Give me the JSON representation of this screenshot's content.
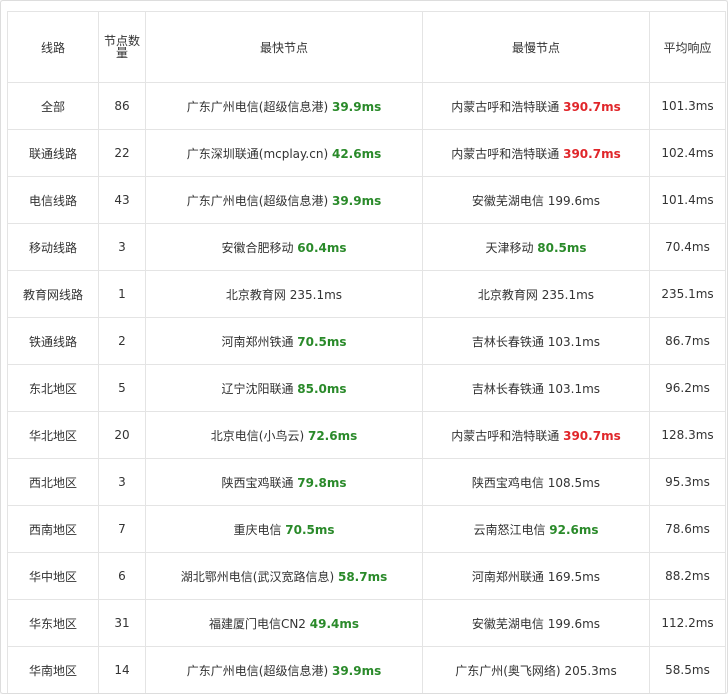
{
  "colors": {
    "fast": "#2a8a2a",
    "slow": "#e0262a",
    "normal": "#333333"
  },
  "headers": {
    "line": "线路",
    "count_line1": "节点数",
    "count_line2": "量",
    "fastest": "最快节点",
    "slowest": "最慢节点",
    "average": "平均响应"
  },
  "rows": [
    {
      "line": "全部",
      "count": "86",
      "fast_node": "广东广州电信(超级信息港)",
      "fast_ms": "39.9ms",
      "fast_style": "fast",
      "slow_node": "内蒙古呼和浩特联通",
      "slow_ms": "390.7ms",
      "slow_style": "slow",
      "avg": "101.3ms"
    },
    {
      "line": "联通线路",
      "count": "22",
      "fast_node": "广东深圳联通(mcplay.cn)",
      "fast_ms": "42.6ms",
      "fast_style": "fast",
      "slow_node": "内蒙古呼和浩特联通",
      "slow_ms": "390.7ms",
      "slow_style": "slow",
      "avg": "102.4ms"
    },
    {
      "line": "电信线路",
      "count": "43",
      "fast_node": "广东广州电信(超级信息港)",
      "fast_ms": "39.9ms",
      "fast_style": "fast",
      "slow_node": "安徽芜湖电信",
      "slow_ms": "199.6ms",
      "slow_style": "plain",
      "avg": "101.4ms"
    },
    {
      "line": "移动线路",
      "count": "3",
      "fast_node": "安徽合肥移动",
      "fast_ms": "60.4ms",
      "fast_style": "fast",
      "slow_node": "天津移动",
      "slow_ms": "80.5ms",
      "slow_style": "fast",
      "avg": "70.4ms"
    },
    {
      "line": "教育网线路",
      "count": "1",
      "fast_node": "北京教育网",
      "fast_ms": "235.1ms",
      "fast_style": "plain",
      "slow_node": "北京教育网",
      "slow_ms": "235.1ms",
      "slow_style": "plain",
      "avg": "235.1ms"
    },
    {
      "line": "铁通线路",
      "count": "2",
      "fast_node": "河南郑州铁通",
      "fast_ms": "70.5ms",
      "fast_style": "fast",
      "slow_node": "吉林长春铁通",
      "slow_ms": "103.1ms",
      "slow_style": "plain",
      "avg": "86.7ms"
    },
    {
      "line": "东北地区",
      "count": "5",
      "fast_node": "辽宁沈阳联通",
      "fast_ms": "85.0ms",
      "fast_style": "fast",
      "slow_node": "吉林长春铁通",
      "slow_ms": "103.1ms",
      "slow_style": "plain",
      "avg": "96.2ms"
    },
    {
      "line": "华北地区",
      "count": "20",
      "fast_node": "北京电信(小鸟云)",
      "fast_ms": "72.6ms",
      "fast_style": "fast",
      "slow_node": "内蒙古呼和浩特联通",
      "slow_ms": "390.7ms",
      "slow_style": "slow",
      "avg": "128.3ms"
    },
    {
      "line": "西北地区",
      "count": "3",
      "fast_node": "陕西宝鸡联通",
      "fast_ms": "79.8ms",
      "fast_style": "fast",
      "slow_node": "陕西宝鸡电信",
      "slow_ms": "108.5ms",
      "slow_style": "plain",
      "avg": "95.3ms"
    },
    {
      "line": "西南地区",
      "count": "7",
      "fast_node": "重庆电信",
      "fast_ms": "70.5ms",
      "fast_style": "fast",
      "slow_node": "云南怒江电信",
      "slow_ms": "92.6ms",
      "slow_style": "fast",
      "avg": "78.6ms"
    },
    {
      "line": "华中地区",
      "count": "6",
      "fast_node": "湖北鄂州电信(武汉宽路信息)",
      "fast_ms": "58.7ms",
      "fast_style": "fast",
      "slow_node": "河南郑州联通",
      "slow_ms": "169.5ms",
      "slow_style": "plain",
      "avg": "88.2ms"
    },
    {
      "line": "华东地区",
      "count": "31",
      "fast_node": "福建厦门电信CN2",
      "fast_ms": "49.4ms",
      "fast_style": "fast",
      "slow_node": "安徽芜湖电信",
      "slow_ms": "199.6ms",
      "slow_style": "plain",
      "avg": "112.2ms"
    },
    {
      "line": "华南地区",
      "count": "14",
      "fast_node": "广东广州电信(超级信息港)",
      "fast_ms": "39.9ms",
      "fast_style": "fast",
      "slow_node": "广东广州(奥飞网络)",
      "slow_ms": "205.3ms",
      "slow_style": "plain",
      "avg": "58.5ms"
    }
  ]
}
